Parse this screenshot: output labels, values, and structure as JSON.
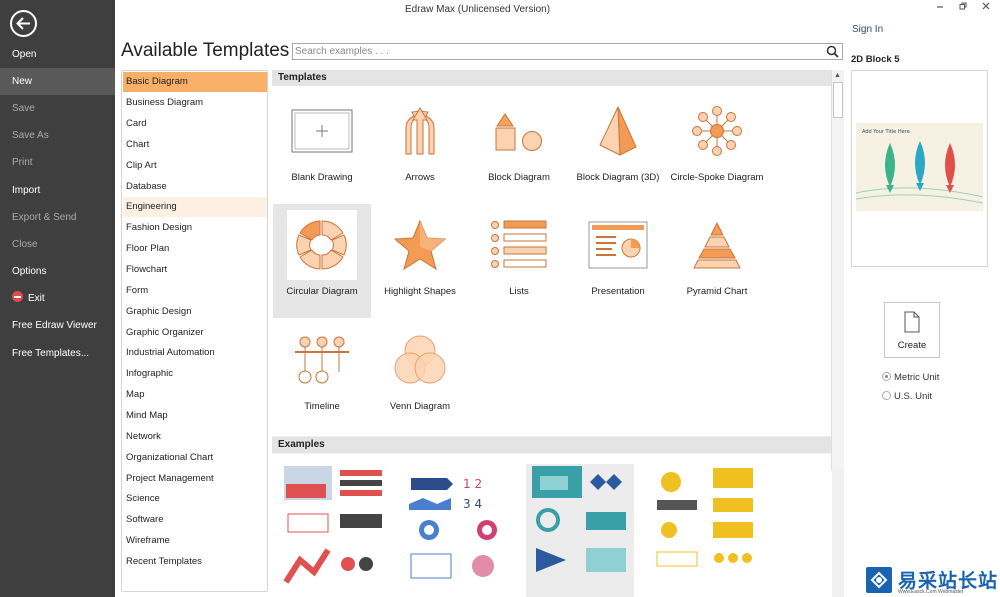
{
  "app": {
    "title": "Edraw Max (Unlicensed Version)",
    "sign_in": "Sign In"
  },
  "nav": {
    "items": [
      {
        "label": "Open"
      },
      {
        "label": "New"
      },
      {
        "label": "Save"
      },
      {
        "label": "Save As"
      },
      {
        "label": "Print"
      },
      {
        "label": "Import"
      },
      {
        "label": "Export & Send"
      },
      {
        "label": "Close"
      },
      {
        "label": "Options"
      },
      {
        "label": "Exit"
      },
      {
        "label": "Free Edraw Viewer"
      },
      {
        "label": "Free Templates..."
      }
    ]
  },
  "header": {
    "title": "Available Templates",
    "search_placeholder": "Search examples . . ."
  },
  "categories": [
    "Basic Diagram",
    "Business Diagram",
    "Card",
    "Chart",
    "Clip Art",
    "Database",
    "Engineering",
    "Fashion Design",
    "Floor Plan",
    "Flowchart",
    "Form",
    "Graphic Design",
    "Graphic Organizer",
    "Industrial Automation",
    "Infographic",
    "Map",
    "Mind Map",
    "Network",
    "Organizational Chart",
    "Project Management",
    "Science",
    "Software",
    "Wireframe",
    "Recent Templates"
  ],
  "panel": {
    "templates_header": "Templates",
    "examples_header": "Examples",
    "templates": [
      {
        "label": "Blank Drawing"
      },
      {
        "label": "Arrows"
      },
      {
        "label": "Block Diagram"
      },
      {
        "label": "Block Diagram (3D)"
      },
      {
        "label": "Circle-Spoke Diagram"
      },
      {
        "label": "Circular Diagram"
      },
      {
        "label": "Highlight Shapes"
      },
      {
        "label": "Lists"
      },
      {
        "label": "Presentation"
      },
      {
        "label": "Pyramid Chart"
      },
      {
        "label": "Timeline"
      },
      {
        "label": "Venn Diagram"
      }
    ]
  },
  "preview": {
    "title": "2D Block 5",
    "caption": "Add Your Title Here",
    "create_label": "Create",
    "units": [
      {
        "label": "Metric Unit",
        "selected": true
      },
      {
        "label": "U.S. Unit",
        "selected": false
      }
    ]
  },
  "watermark": {
    "text": "易采站长站",
    "subtext": "Www.Easck.Com Webmaster"
  },
  "colors": {
    "accent": "#f8b068",
    "nav_bg": "#3f3f3f",
    "shape_fill": "#fbd3b1",
    "shape_stroke": "#e38a46"
  }
}
